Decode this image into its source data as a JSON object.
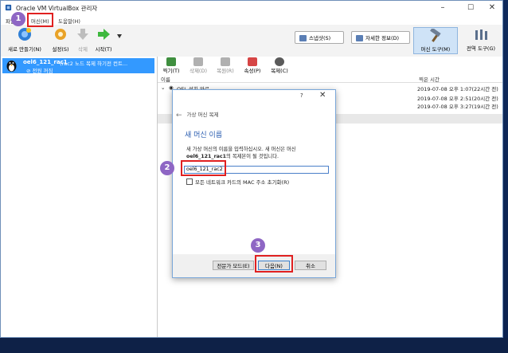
{
  "window": {
    "title": "Oracle VM VirtualBox 관리자",
    "min": "–",
    "max": "☐",
    "close": "✕"
  },
  "menu": {
    "file": "파일",
    "machine": "머신(M)",
    "help": "도움말(H)"
  },
  "toolbar": {
    "new": "새로 만들기(N)",
    "settings": "설정(S)",
    "discard": "삭제",
    "start": "시작(T)",
    "snapshots": "스냅샷(S)",
    "details": "자세한 정보(D)",
    "machine_tools": "머신 도구(M)",
    "global_tools": "전역 도구(G)"
  },
  "vm": {
    "name": "oel6_121_rac1",
    "note": "(rac2 노드 복제 하기전 컨트...",
    "state": "전원 꺼짐"
  },
  "snap_toolbar": {
    "take": "찍기(T)",
    "delete": "삭제(D)",
    "restore": "복원(R)",
    "props": "속성(P)",
    "clone": "복제(C)"
  },
  "snap_table": {
    "col_name": "이름",
    "col_time": "찍은 시간",
    "rows": [
      {
        "name": "OEL 설치 완료",
        "time": "2019-07-08 오후 1:07(22시간 전)"
      },
      {
        "name": "",
        "time": "2019-07-08 오후 2:51(20시간 전)"
      },
      {
        "name": "",
        "time": "2019-07-08 오후 3:27(19시간 전)"
      }
    ]
  },
  "dialog": {
    "help": "?",
    "close": "✕",
    "back_title": "가상 머신 복제",
    "heading": "새 머신 이름",
    "desc_line1": "새 가상 머신의 이름을 입력하십시오. 새 머신은 머신",
    "desc_bold": "oel6_121_rac1",
    "desc_line2": "의 복제본이 될 것입니다.",
    "name_value": "oel6_121_rac2",
    "reinit_mac": "모든 네트워크 카드의 MAC 주소 초기화(R)",
    "expert": "전문가 모드(E)",
    "next": "다음(N)",
    "cancel": "취소"
  },
  "badges": {
    "b1": "1",
    "b2": "2",
    "b3": "3"
  },
  "colors": {
    "selection": "#3399ff",
    "badge": "#8e66c4",
    "highlight": "#e02020",
    "heading": "#2a5db0"
  }
}
